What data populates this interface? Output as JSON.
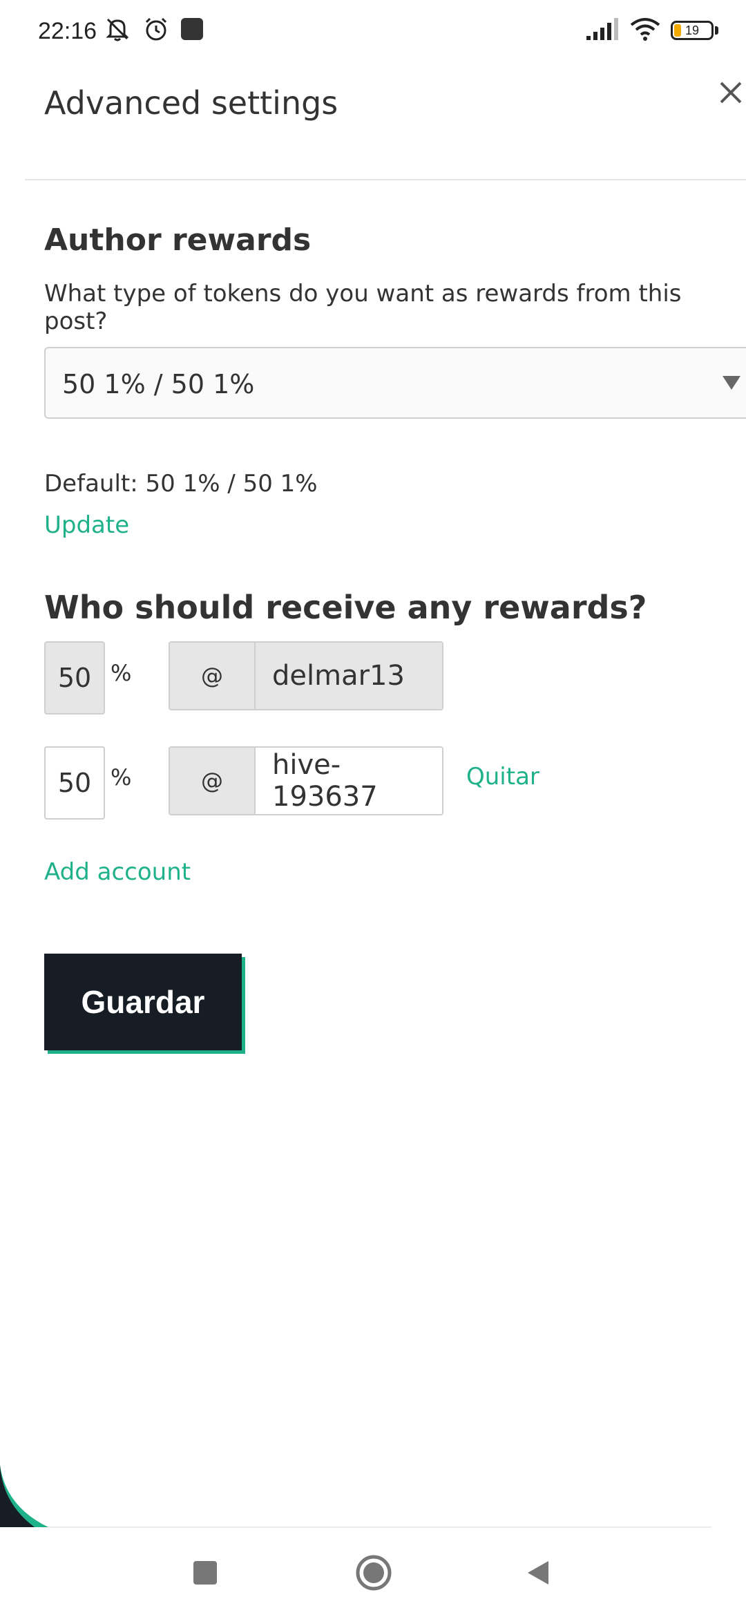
{
  "status_bar": {
    "time": "22:16",
    "battery_level": "19",
    "battery_fraction": 0.19,
    "icons": [
      "mute-icon",
      "alarm-icon",
      "app-notification-icon",
      "signal-icon",
      "wifi-icon",
      "battery-icon"
    ]
  },
  "header": {
    "title": "Advanced settings",
    "close_icon": "close-icon"
  },
  "author_rewards": {
    "heading": "Author rewards",
    "description": "What type of tokens do you want as rewards from this post?",
    "selected_option": "50 1% / 50 1%",
    "default_text": "Default: 50 1% / 50 1%",
    "update_label": "Update"
  },
  "beneficiaries": {
    "heading": "Who should receive any rewards?",
    "percent_sign": "%",
    "at_sign": "@",
    "rows": [
      {
        "percent": "50",
        "account": "delmar13",
        "editable": false
      },
      {
        "percent": "50",
        "account": "hive-193637",
        "editable": true,
        "remove_label": "Quitar"
      }
    ],
    "add_account_label": "Add account"
  },
  "actions": {
    "save_label": "Guardar"
  },
  "colors": {
    "accent": "#1fb28a",
    "button_bg": "#171d24",
    "text": "#333333",
    "disabled_bg": "#e6e6e6"
  }
}
